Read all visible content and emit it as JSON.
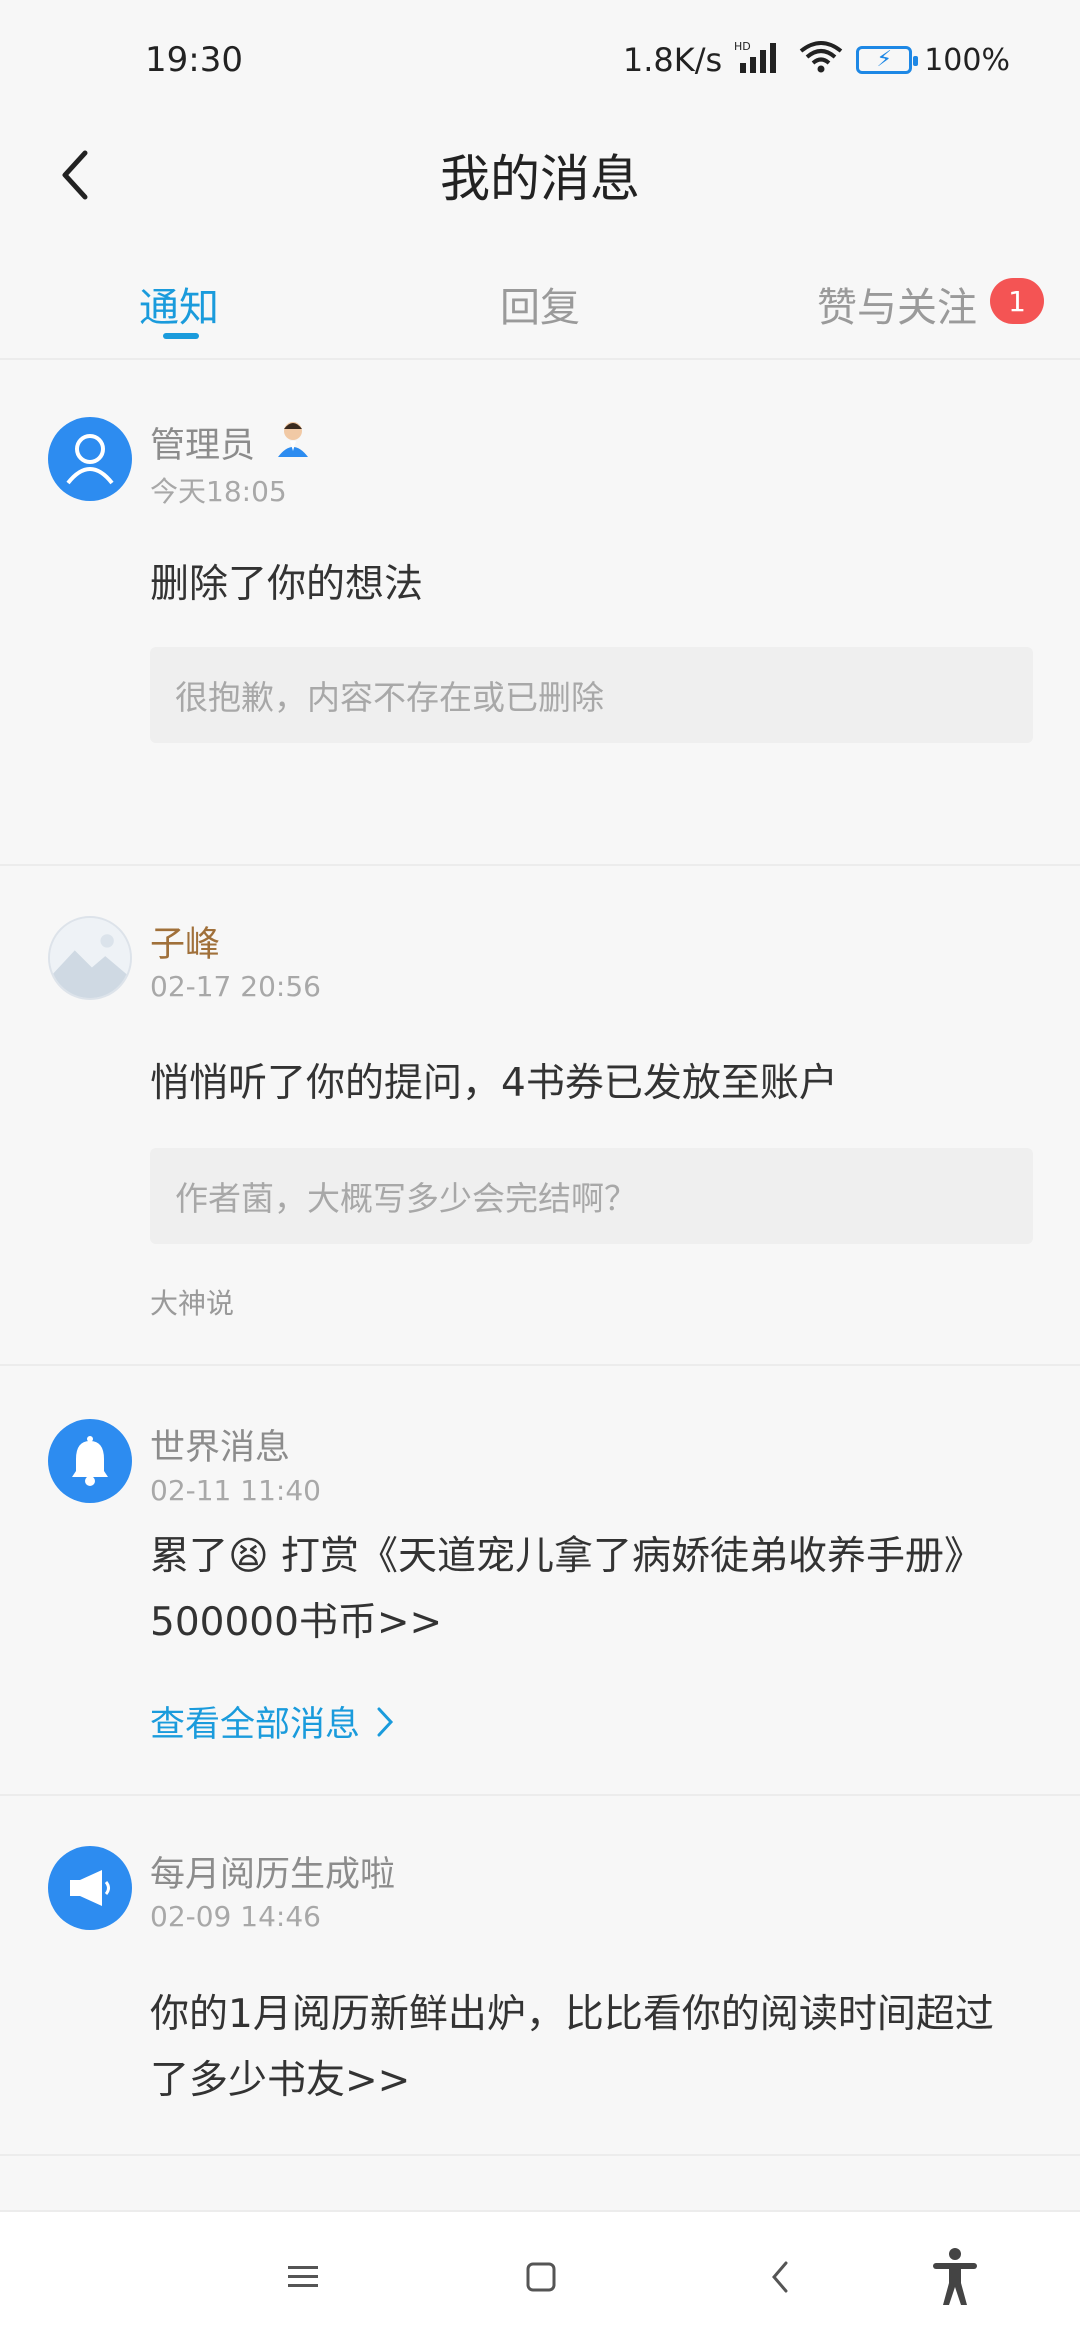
{
  "status_bar": {
    "time": "19:30",
    "network_speed": "1.8K/s",
    "battery_percent": "100%"
  },
  "header": {
    "title": "我的消息"
  },
  "tabs": [
    {
      "label": "通知",
      "active": true
    },
    {
      "label": "回复",
      "active": false
    },
    {
      "label": "赞与关注",
      "active": false,
      "badge": "1"
    }
  ],
  "messages": [
    {
      "sender": "管理员",
      "time": "今天18:05",
      "body": "删除了你的想法",
      "quote": "很抱歉，内容不存在或已删除"
    },
    {
      "sender": "子峰",
      "time": "02-17 20:56",
      "body": "悄悄听了你的提问，4书券已发放至账户",
      "quote": "作者菌，大概写多少会完结啊？",
      "source": "大神说"
    },
    {
      "sender": "世界消息",
      "time": "02-11 11:40",
      "body": "累了😫 打赏《天道宠儿拿了病娇徒弟收养手册》500000书币>>",
      "link": "查看全部消息"
    },
    {
      "sender": "每月阅历生成啦",
      "time": "02-09 14:46",
      "body": "你的1月阅历新鲜出炉，比比看你的阅读时间超过了多少书友>>"
    }
  ],
  "colors": {
    "accent": "#1a9bdc",
    "badge": "#f45454",
    "avatar_blue": "#2d8cf0",
    "sender_brown": "#a0703a"
  }
}
